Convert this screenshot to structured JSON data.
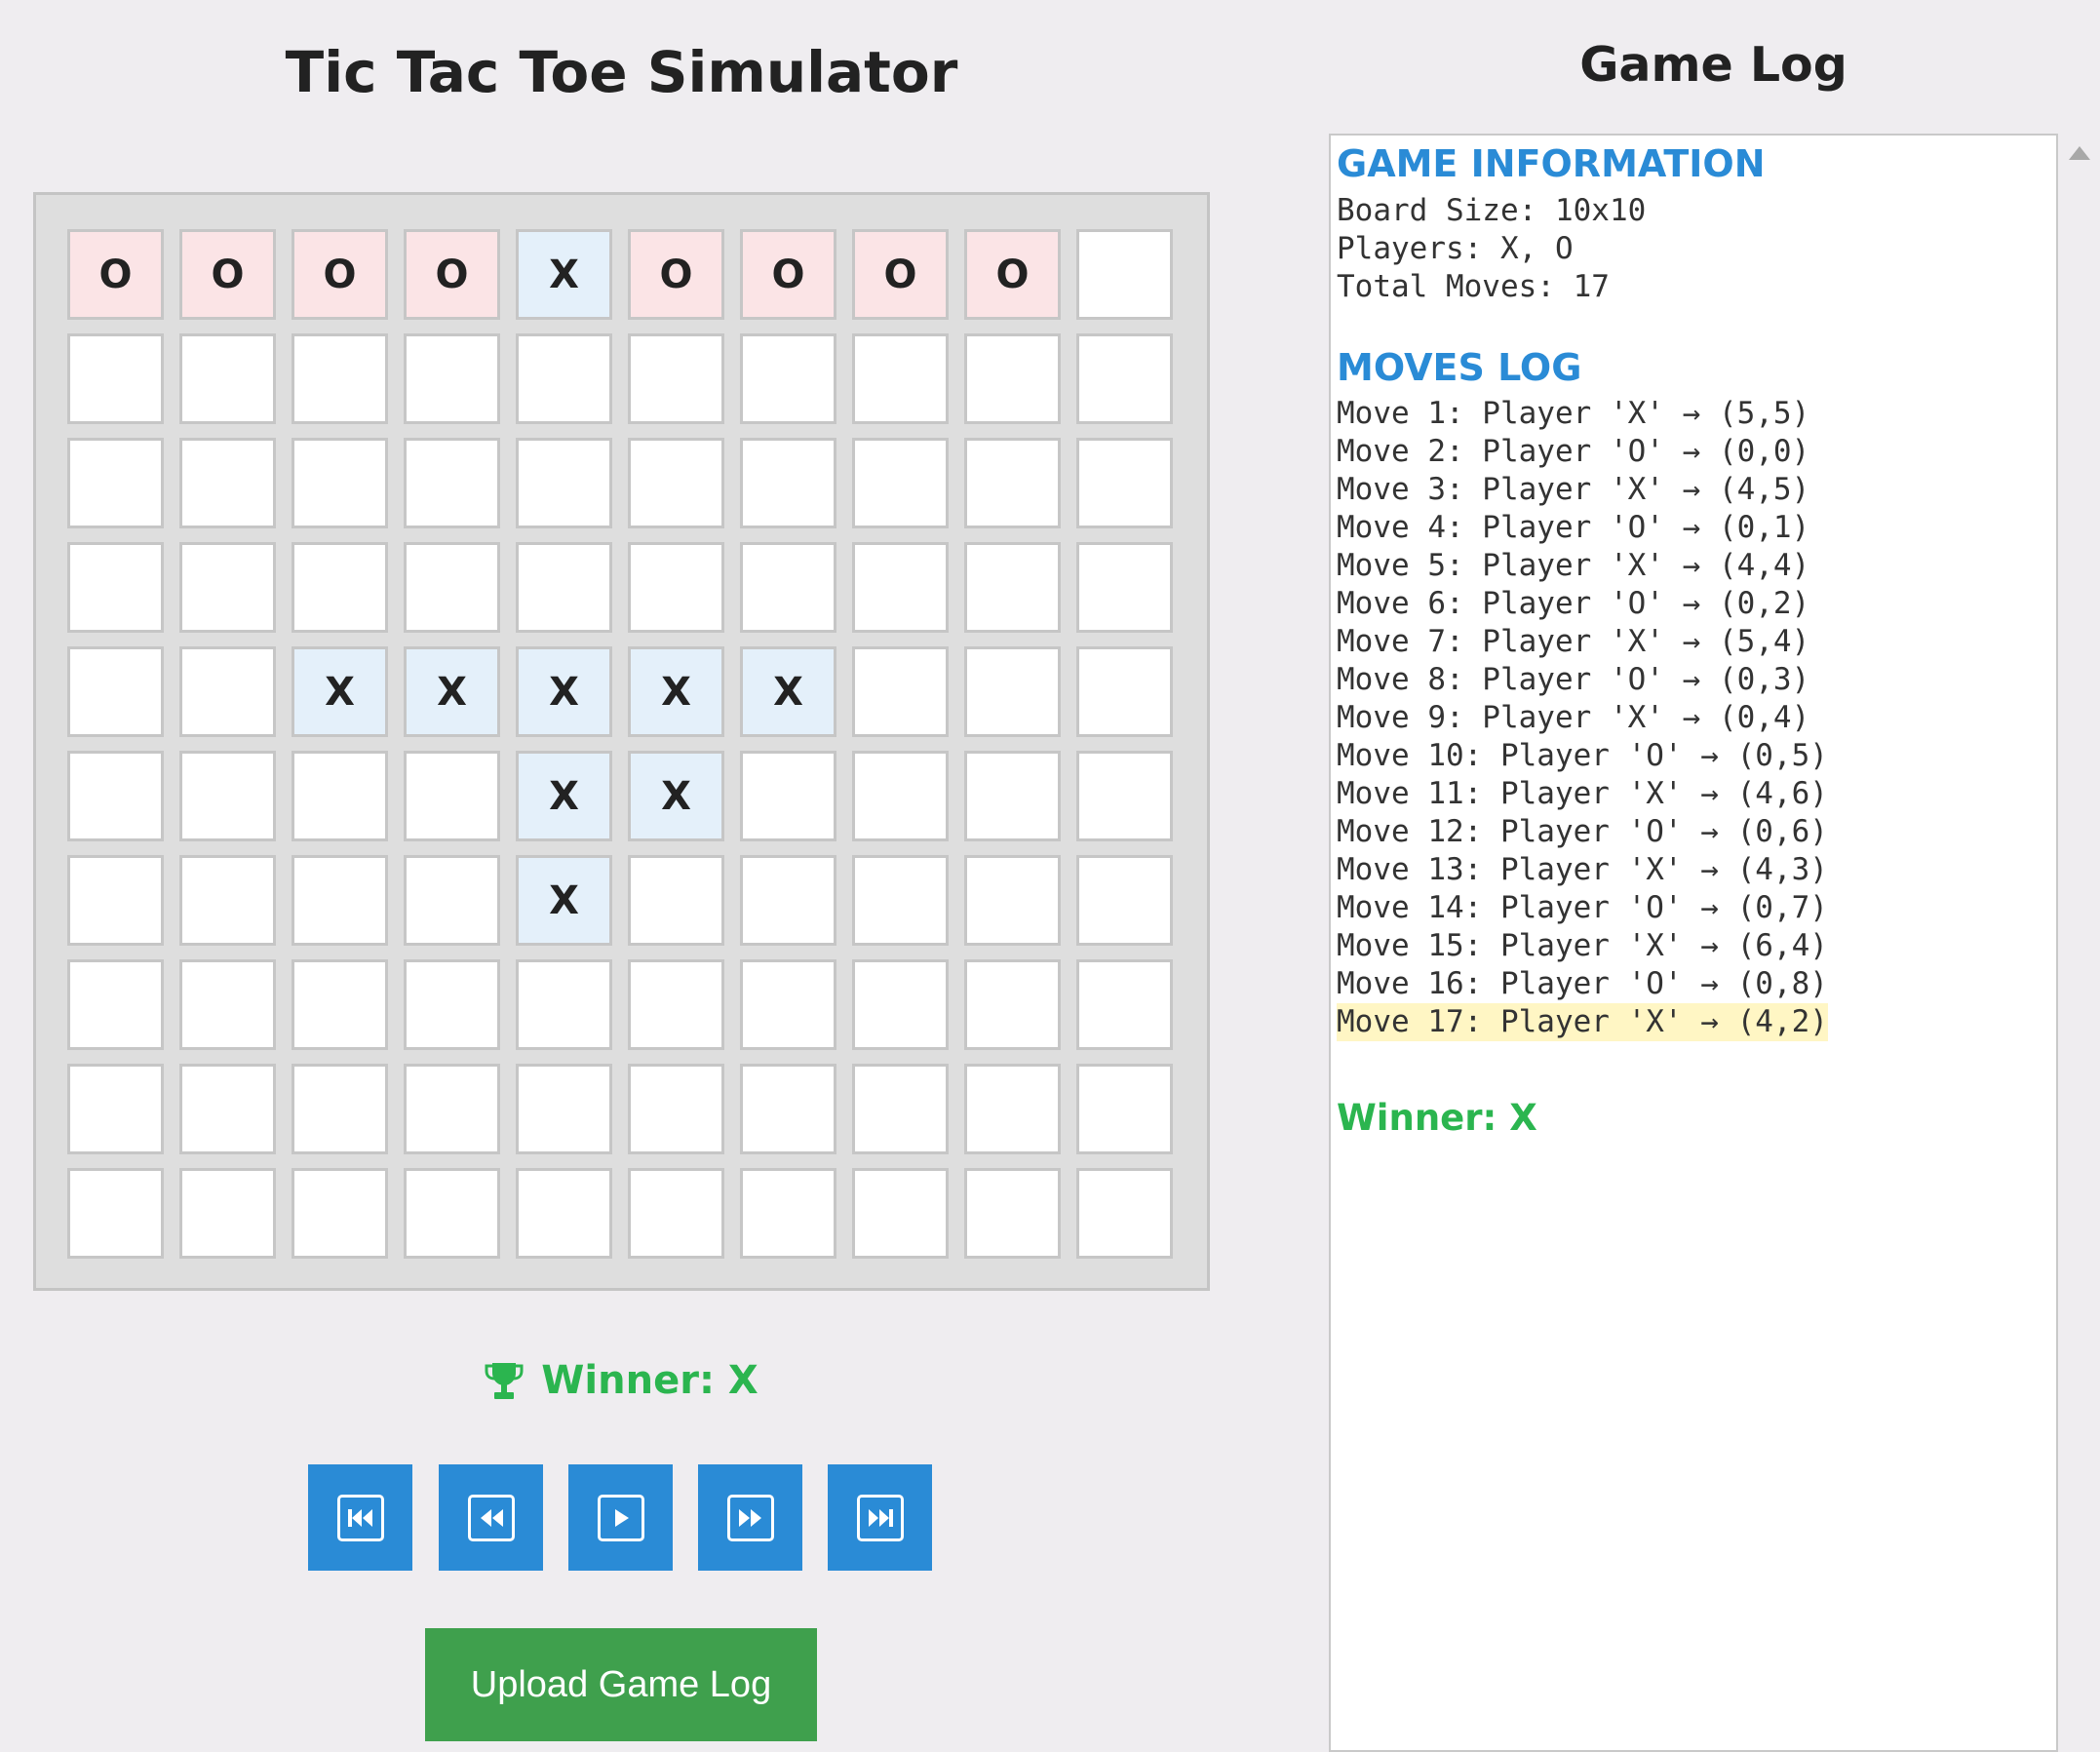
{
  "app": {
    "title": "Tic Tac Toe Simulator"
  },
  "board": {
    "rows": [
      [
        "O",
        "O",
        "O",
        "O",
        "X",
        "O",
        "O",
        "O",
        "O",
        ""
      ],
      [
        "",
        "",
        "",
        "",
        "",
        "",
        "",
        "",
        "",
        ""
      ],
      [
        "",
        "",
        "",
        "",
        "",
        "",
        "",
        "",
        "",
        ""
      ],
      [
        "",
        "",
        "",
        "",
        "",
        "",
        "",
        "",
        "",
        ""
      ],
      [
        "",
        "",
        "X",
        "X",
        "X",
        "X",
        "X",
        "",
        "",
        ""
      ],
      [
        "",
        "",
        "",
        "",
        "X",
        "X",
        "",
        "",
        "",
        ""
      ],
      [
        "",
        "",
        "",
        "",
        "X",
        "",
        "",
        "",
        "",
        ""
      ],
      [
        "",
        "",
        "",
        "",
        "",
        "",
        "",
        "",
        "",
        ""
      ],
      [
        "",
        "",
        "",
        "",
        "",
        "",
        "",
        "",
        "",
        ""
      ],
      [
        "",
        "",
        "",
        "",
        "",
        "",
        "",
        "",
        "",
        ""
      ]
    ]
  },
  "status": {
    "icon": "trophy-icon",
    "text": "Winner: X"
  },
  "controls": [
    {
      "name": "first-move-button",
      "icon": "skip-to-start-icon"
    },
    {
      "name": "previous-move-button",
      "icon": "step-back-icon"
    },
    {
      "name": "play-button",
      "icon": "play-icon"
    },
    {
      "name": "next-move-button",
      "icon": "step-forward-icon"
    },
    {
      "name": "last-move-button",
      "icon": "skip-to-end-icon"
    }
  ],
  "upload_label": "Upload Game Log",
  "log": {
    "title": "Game Log",
    "info_heading": "GAME INFORMATION",
    "info_lines": [
      "Board Size: 10x10",
      "Players: X, O",
      "Total Moves: 17"
    ],
    "moves_heading": "MOVES LOG",
    "moves": [
      "Move 1: Player 'X' → (5,5)",
      "Move 2: Player 'O' → (0,0)",
      "Move 3: Player 'X' → (4,5)",
      "Move 4: Player 'O' → (0,1)",
      "Move 5: Player 'X' → (4,4)",
      "Move 6: Player 'O' → (0,2)",
      "Move 7: Player 'X' → (5,4)",
      "Move 8: Player 'O' → (0,3)",
      "Move 9: Player 'X' → (0,4)",
      "Move 10: Player 'O' → (0,5)",
      "Move 11: Player 'X' → (4,6)",
      "Move 12: Player 'O' → (0,6)",
      "Move 13: Player 'X' → (4,3)",
      "Move 14: Player 'O' → (0,7)",
      "Move 15: Player 'X' → (6,4)",
      "Move 16: Player 'O' → (0,8)",
      "Move 17: Player 'X' → (4,2)"
    ],
    "current_move_index": 16,
    "winner": "Winner: X"
  },
  "colors": {
    "x_cell": "#e4f0fa",
    "o_cell": "#fbe4e6",
    "accent_blue": "#2a8bd6",
    "win_green": "#2bb54f",
    "upload_green": "#3fa04d",
    "current_move_highlight": "#fff6c4"
  }
}
